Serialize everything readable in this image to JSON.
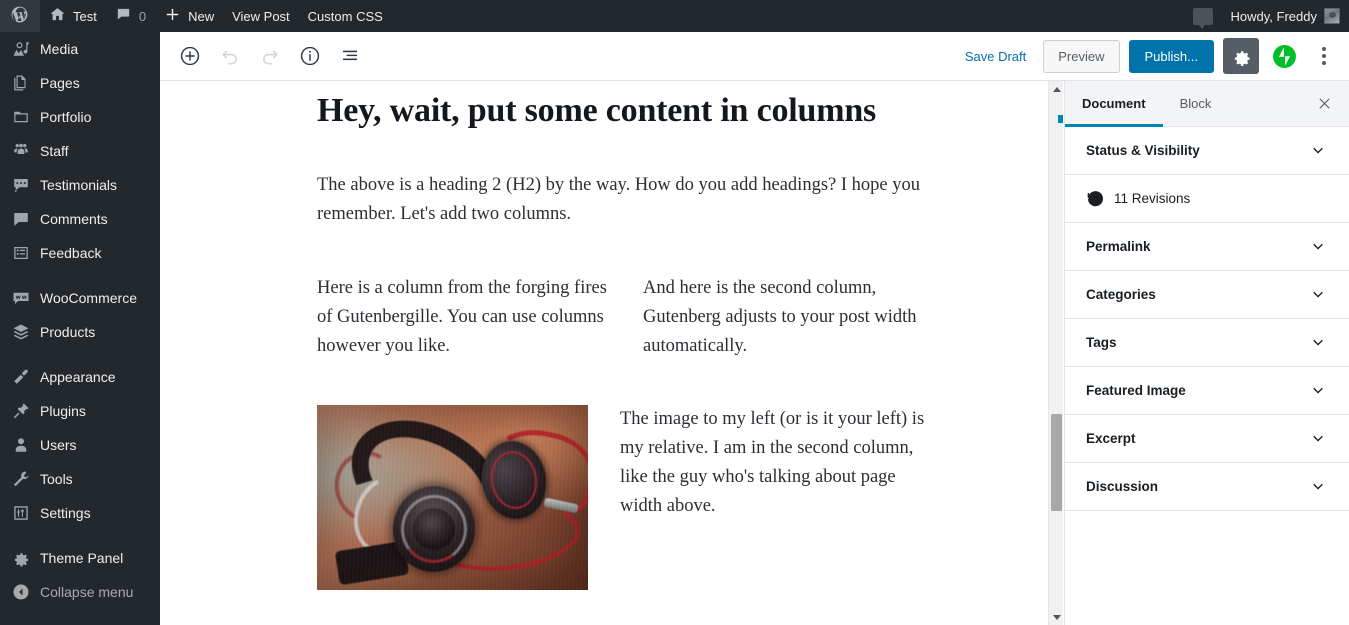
{
  "adminbar": {
    "logo_icon": "wordpress-logo-icon",
    "site": {
      "label": "Test",
      "icon": "home-icon"
    },
    "comments": {
      "count": "0",
      "icon": "comment-bubble-icon"
    },
    "new": {
      "label": "New",
      "icon": "plus-icon"
    },
    "view_post": {
      "label": "View Post"
    },
    "custom_css": {
      "label": "Custom CSS"
    },
    "notifications_icon": "comment-bubble-icon",
    "howdy": {
      "label": "Howdy, Freddy",
      "avatar": "user-avatar"
    }
  },
  "adminmenu": {
    "items": [
      {
        "label": "Media",
        "icon": "media-icon"
      },
      {
        "label": "Pages",
        "icon": "pages-icon"
      },
      {
        "label": "Portfolio",
        "icon": "portfolio-icon"
      },
      {
        "label": "Staff",
        "icon": "staff-icon"
      },
      {
        "label": "Testimonials",
        "icon": "testimonials-icon"
      },
      {
        "label": "Comments",
        "icon": "comments-icon"
      },
      {
        "label": "Feedback",
        "icon": "feedback-icon"
      },
      {
        "label": "WooCommerce",
        "icon": "woocommerce-icon"
      },
      {
        "label": "Products",
        "icon": "products-icon"
      },
      {
        "label": "Appearance",
        "icon": "appearance-icon"
      },
      {
        "label": "Plugins",
        "icon": "plugins-icon"
      },
      {
        "label": "Users",
        "icon": "users-icon"
      },
      {
        "label": "Tools",
        "icon": "tools-icon"
      },
      {
        "label": "Settings",
        "icon": "settings-icon"
      },
      {
        "label": "Theme Panel",
        "icon": "theme-panel-icon"
      },
      {
        "label": "Collapse menu",
        "icon": "collapse-arrow-icon"
      }
    ]
  },
  "editor_header": {
    "add_block": {
      "name": "add-block-icon",
      "title": "Add block"
    },
    "undo": {
      "name": "undo-icon",
      "title": "Undo",
      "disabled": true
    },
    "redo": {
      "name": "redo-icon",
      "title": "Redo",
      "disabled": true
    },
    "info": {
      "name": "content-info-icon",
      "title": "Content structure"
    },
    "block_nav": {
      "name": "block-navigation-icon",
      "title": "Block navigation"
    },
    "save_draft_label": "Save Draft",
    "preview_label": "Preview",
    "publish_label": "Publish...",
    "settings_gear": {
      "name": "gear-icon",
      "active": true
    },
    "jetpack": {
      "name": "jetpack-icon",
      "color": "#00be28"
    },
    "more_menu": {
      "name": "more-vertical-icon"
    }
  },
  "post": {
    "title": "Hey, wait, put some content in columns",
    "intro": "The above is a heading 2 (H2) by the way. How do you add headings? I hope you remember. Let's add two columns.",
    "columns_text": {
      "left": "Here is a column from the forging fires of Gutenbergille. You can use columns however you like.",
      "right": "And here is the second column, Gutenberg adjusts to your post width automatically."
    },
    "columns_media": {
      "image_alt": "Black over-ear headphones with a red cable resting on a wooden desk",
      "right": "The image to my left (or is it your left) is my relative. I am in the second column, like the guy who's talking about page width above."
    }
  },
  "content_scrollbar": {
    "name": "content-vertical-scrollbar",
    "up_arrow": "scroll-up-arrow-icon",
    "down_arrow": "scroll-down-arrow-icon"
  },
  "settings_sidebar": {
    "tabs": [
      {
        "label": "Document",
        "active": true
      },
      {
        "label": "Block",
        "active": false
      }
    ],
    "close_icon": "close-icon",
    "panels": [
      {
        "label": "Status & Visibility",
        "type": "accordion"
      },
      {
        "label": "11 Revisions",
        "type": "link",
        "icon": "revisions-clock-icon"
      },
      {
        "label": "Permalink",
        "type": "accordion"
      },
      {
        "label": "Categories",
        "type": "accordion"
      },
      {
        "label": "Tags",
        "type": "accordion"
      },
      {
        "label": "Featured Image",
        "type": "accordion"
      },
      {
        "label": "Excerpt",
        "type": "accordion"
      },
      {
        "label": "Discussion",
        "type": "accordion"
      }
    ]
  },
  "colors": {
    "admin_dark": "#23282d",
    "wp_blue": "#0073aa",
    "tab_accent": "#0085ba",
    "jetpack_green": "#00be28",
    "gear_active_bg": "#555d66"
  }
}
